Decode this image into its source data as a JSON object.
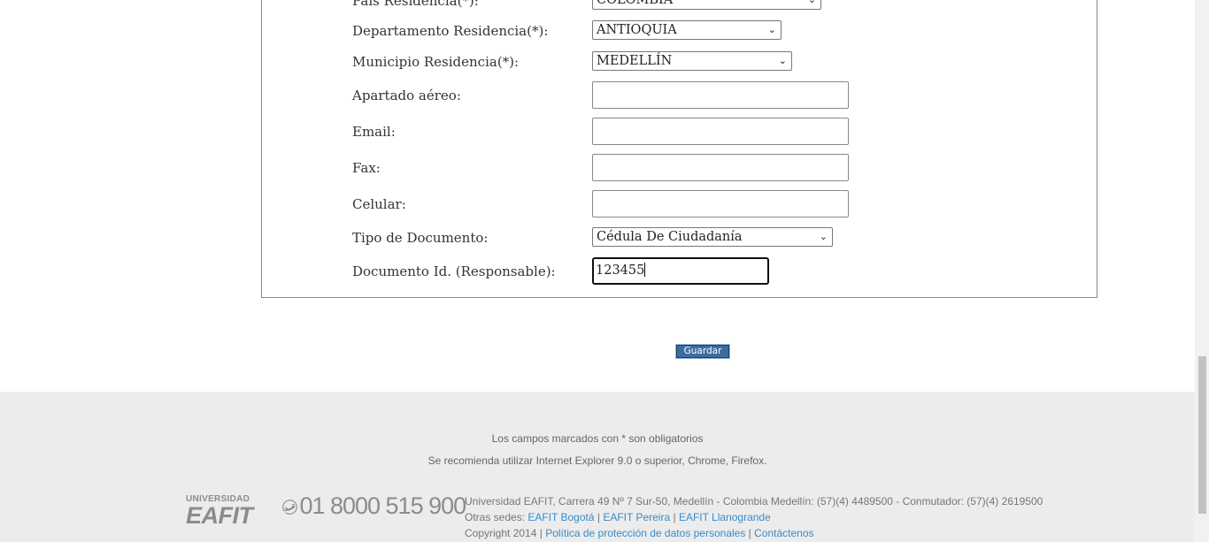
{
  "form": {
    "fields": [
      {
        "label": "País Residencia(*):",
        "value": "COLOMBIA"
      },
      {
        "label": "Departamento Residencia(*):",
        "value": "ANTIOQUIA"
      },
      {
        "label": "Municipio Residencia(*):",
        "value": "MEDELLÍN"
      },
      {
        "label": "Apartado aéreo:",
        "value": ""
      },
      {
        "label": "Email:",
        "value": ""
      },
      {
        "label": "Fax:",
        "value": ""
      },
      {
        "label": "Celular:",
        "value": ""
      },
      {
        "label": "Tipo de Documento:",
        "value": "Cédula De Ciudadanía"
      },
      {
        "label": "Documento Id. (Responsable):",
        "value": "123455"
      }
    ],
    "submit_label": "Guardar"
  },
  "footer": {
    "required_note": "Los campos marcados con * son obligatorios",
    "browser_note": "Se recomienda utilizar Internet Explorer 9.0 o superior, Chrome, Firefox.",
    "logo_top": "UNIVERSIDAD",
    "logo_main": "EAFIT",
    "phone": "01 8000 515 900",
    "address": "Universidad EAFIT, Carrera 49 Nº 7 Sur-50, Medellín - Colombia Medellín: (57)(4) 4489500 - Conmutador: (57)(4) 2619500",
    "other_sites_label": "Otras sedes:",
    "other_sites": [
      "EAFIT Bogotá",
      "EAFIT Pereira",
      "EAFIT Llanogrande"
    ],
    "copyright": "Copyright 2014 |",
    "links": [
      "Política de protección de datos personales",
      "Contáctenos"
    ]
  },
  "icons": {
    "phone": "phone-icon",
    "dropdown": "chevron-down-icon"
  }
}
